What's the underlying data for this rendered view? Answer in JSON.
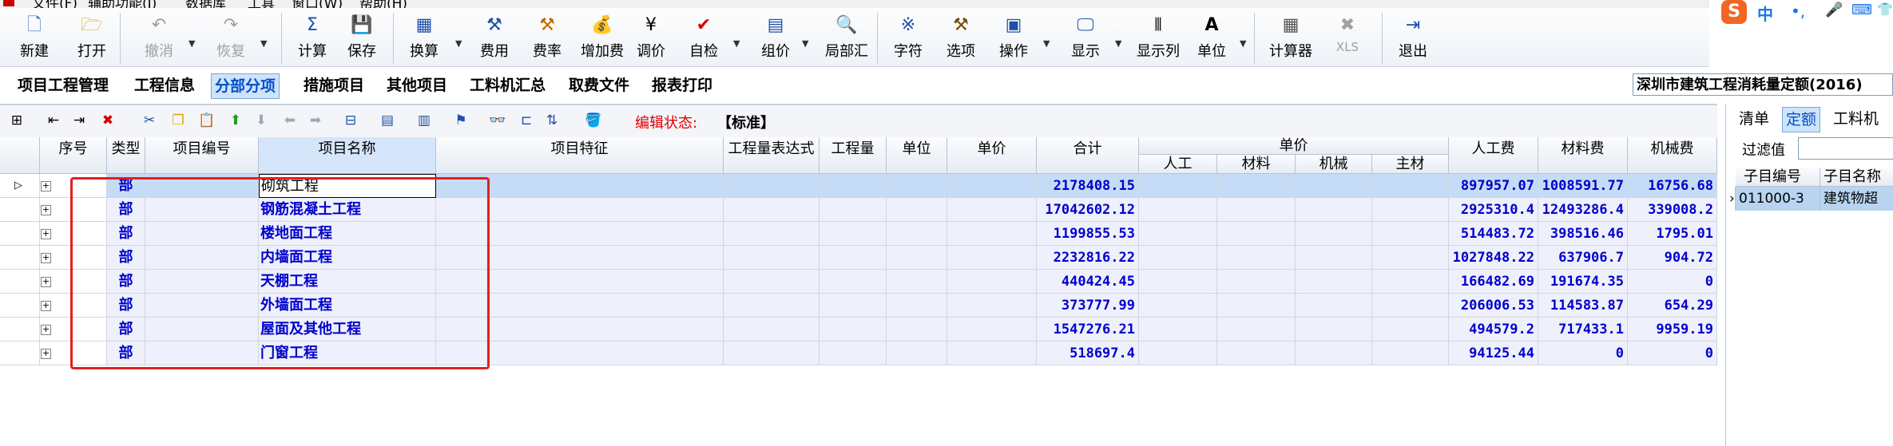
{
  "menu": [
    "文件(F)",
    "辅助功能(I)",
    "数据库",
    "工具",
    "窗口(W)",
    "帮助(H)"
  ],
  "ime": {
    "cn": "中",
    "punct": "•,",
    "mic": "🎤",
    "keyboard": "⌨",
    "shirt": "👕"
  },
  "toolbar": {
    "new": "新建",
    "open": "打开",
    "undo": "撤消",
    "redo": "恢复",
    "calc": "计算",
    "save": "保存",
    "convert": "换算",
    "fee": "费用",
    "rate": "费率",
    "add_fee": "增加费",
    "adjust_price": "调价",
    "self_check": "自检",
    "group_price": "组价",
    "local_summary": "局部汇",
    "font": "字符",
    "options": "选项",
    "operation": "操作",
    "display": "显示",
    "display_cols": "显示列",
    "unit": "单位",
    "calculator": "计算器",
    "xls": "XLS",
    "exit": "退出"
  },
  "tabs": [
    "项目工程管理",
    "工程信息",
    "分部分项",
    "措施项目",
    "其他项目",
    "工料机汇总",
    "取费文件",
    "报表打印"
  ],
  "active_tab": "分部分项",
  "quota": "深圳市建筑工程消耗量定额(2016)",
  "edit_status": {
    "label": "编辑状态:",
    "value": "【标准】"
  },
  "columns": {
    "seq": "序号",
    "type": "类型",
    "code": "项目编号",
    "name": "项目名称",
    "feature": "项目特征",
    "qty_expr": "工程量表达式",
    "qty": "工程量",
    "unit": "单位",
    "unit_price": "单价",
    "total": "合计",
    "unit_price_group": "单价",
    "labor": "人工",
    "material": "材料",
    "machine": "机械",
    "main_material": "主材",
    "labor_fee": "人工费",
    "material_fee": "材料费",
    "machine_fee": "机械费"
  },
  "rows": [
    {
      "type": "部",
      "name": "砌筑工程",
      "total": "2178408.15",
      "labor_fee": "897957.07",
      "material_fee": "1008591.77",
      "machine_fee": "16756.68"
    },
    {
      "type": "部",
      "name": "钢筋混凝土工程",
      "total": "17042602.12",
      "labor_fee": "2925310.4",
      "material_fee": "12493286.4",
      "machine_fee": "339008.2"
    },
    {
      "type": "部",
      "name": "楼地面工程",
      "total": "1199855.53",
      "labor_fee": "514483.72",
      "material_fee": "398516.46",
      "machine_fee": "1795.01"
    },
    {
      "type": "部",
      "name": "内墙面工程",
      "total": "2232816.22",
      "labor_fee": "1027848.22",
      "material_fee": "637906.7",
      "machine_fee": "904.72"
    },
    {
      "type": "部",
      "name": "天棚工程",
      "total": "440424.45",
      "labor_fee": "166482.69",
      "material_fee": "191674.35",
      "machine_fee": "0"
    },
    {
      "type": "部",
      "name": "外墙面工程",
      "total": "373777.99",
      "labor_fee": "206006.53",
      "material_fee": "114583.87",
      "machine_fee": "654.29"
    },
    {
      "type": "部",
      "name": "屋面及其他工程",
      "total": "1547276.21",
      "labor_fee": "494579.2",
      "material_fee": "717433.1",
      "machine_fee": "9959.19"
    },
    {
      "type": "部",
      "name": "门窗工程",
      "total": "518697.4",
      "labor_fee": "94125.44",
      "material_fee": "0",
      "machine_fee": "0"
    }
  ],
  "right_panel": {
    "tabs": [
      "清单",
      "定额",
      "工料机"
    ],
    "active_tab": "定额",
    "filter_label": "过滤值",
    "col_code": "子目编号",
    "col_name": "子目名称",
    "row_code": "011000-3",
    "row_name": "建筑物超"
  }
}
